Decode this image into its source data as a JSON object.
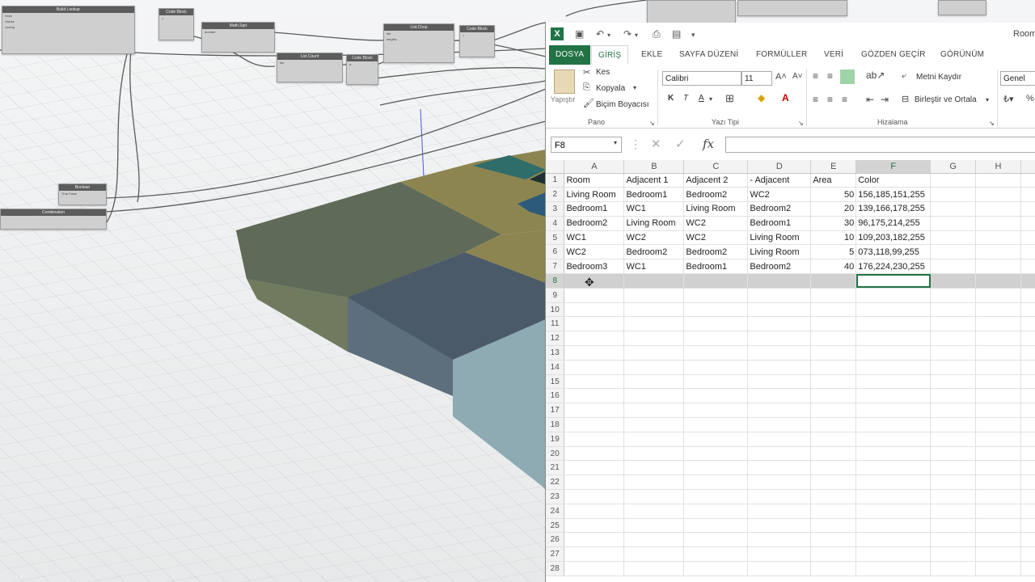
{
  "dynamo": {
    "nodes": [
      {
        "title": "Build Lookup",
        "ports": [
          "Keys",
          "Values",
          "Lacing"
        ]
      },
      {
        "title": "Code Block",
        "ports": [
          ">"
        ]
      },
      {
        "title": "Math.Sqrt",
        "ports": [
          "number"
        ]
      },
      {
        "title": "List.Count",
        "ports": [
          "list"
        ]
      },
      {
        "title": "Code Block",
        "ports": [
          "a"
        ]
      },
      {
        "title": "List.Chop",
        "ports": [
          "list",
          "lengths"
        ]
      },
      {
        "title": "Code Block",
        "ports": [
          ">"
        ]
      },
      {
        "title": "Boolean",
        "ports": [
          "True  False"
        ]
      },
      {
        "title": "Combination",
        "ports": [
          ""
        ]
      }
    ]
  },
  "excel": {
    "title_partial": "Room",
    "tabs": {
      "file": "DOSYA",
      "home": "GİRİŞ",
      "insert": "EKLE",
      "page_layout": "SAYFA DÜZENİ",
      "formulas": "FORMÜLLER",
      "data": "VERİ",
      "review": "GÖZDEN GEÇİR",
      "view": "GÖRÜNÜM"
    },
    "clipboard": {
      "paste": "Yapıştır",
      "cut": "Kes",
      "copy": "Kopyala",
      "format_painter": "Biçim Boyacısı",
      "group": "Pano"
    },
    "font": {
      "name": "Calibri",
      "size": "11",
      "bold": "K",
      "italic": "T",
      "underline": "A",
      "group": "Yazı Tipi"
    },
    "alignment": {
      "wrap_text": "Metni Kaydır",
      "merge_center": "Birleştir ve Ortala",
      "group": "Hizalama"
    },
    "number": {
      "format": "Genel"
    },
    "name_box": "F8",
    "fx_label": "fx",
    "columns": [
      "A",
      "B",
      "C",
      "D",
      "E",
      "F",
      "G",
      "H"
    ],
    "rows": [
      [
        "Room",
        "Adjacent 1",
        "Adjacent 2",
        "- Adjacent",
        "Area",
        "Color",
        "",
        ""
      ],
      [
        "Living Room",
        "Bedroom1",
        "Bedroom2",
        "WC2",
        "50",
        "156,185,151,255",
        "",
        ""
      ],
      [
        "Bedroom1",
        "WC1",
        "Living Room",
        "Bedroom2",
        "20",
        "139,166,178,255",
        "",
        ""
      ],
      [
        "Bedroom2",
        "Living Room",
        "WC2",
        "Bedroom1",
        "30",
        "96,175,214,255",
        "",
        ""
      ],
      [
        "WC1",
        "WC2",
        "WC2",
        "Living Room",
        "10",
        "109,203,182,255",
        "",
        ""
      ],
      [
        "WC2",
        "Bedroom2",
        "Bedroom2",
        "Living Room",
        "5",
        "073,118,99,255",
        "",
        ""
      ],
      [
        "Bedroom3",
        "WC1",
        "Bedroom1",
        "Bedroom2",
        "40",
        "176,224,230,255",
        "",
        ""
      ]
    ],
    "row_numbers": [
      "1",
      "2",
      "3",
      "4",
      "5",
      "6",
      "7",
      "8",
      "9",
      "10",
      "11",
      "12",
      "13",
      "14",
      "15",
      "16",
      "17",
      "18",
      "19",
      "20",
      "21",
      "22",
      "23",
      "24",
      "25",
      "26",
      "27",
      "28"
    ]
  }
}
